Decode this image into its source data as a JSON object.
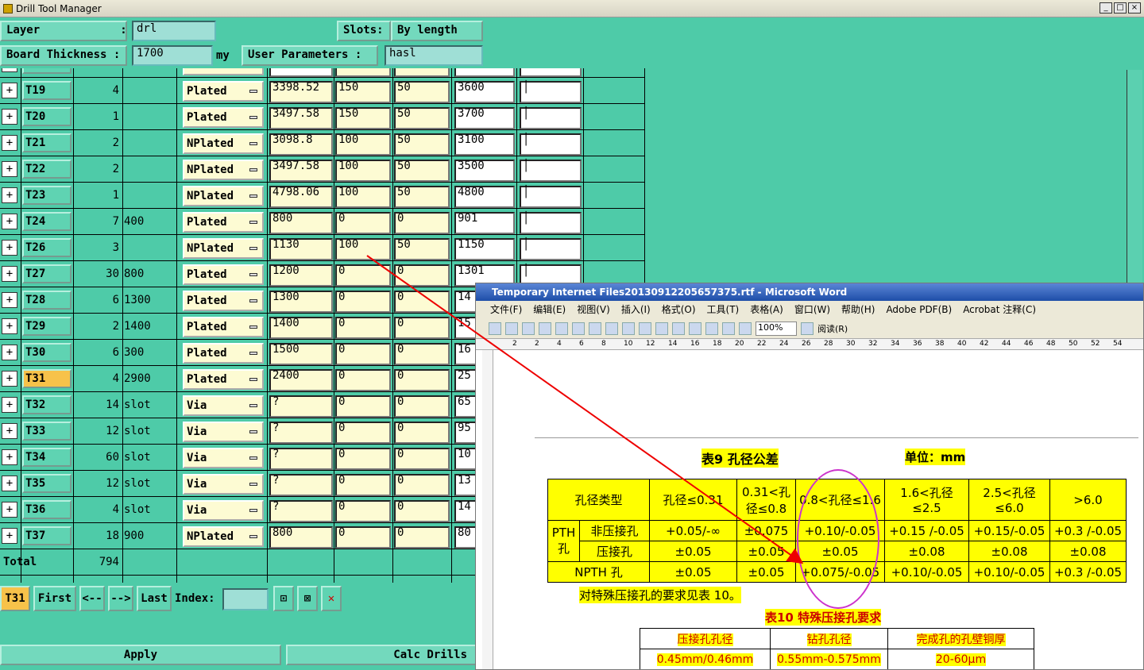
{
  "window": {
    "title": "Drill Tool Manager"
  },
  "header": {
    "layer_label": "Layer            :",
    "layer_value": "drl",
    "slots_label": "Slots:",
    "slots_value": "By length",
    "board_label": "Board Thickness :",
    "board_value": "1700",
    "board_unit": "my",
    "user_params_label": "User Parameters :",
    "user_params_value": "hasl"
  },
  "rows": [
    {
      "tool": "T19",
      "count": "4",
      "minor": "",
      "type": "Plated",
      "c1": "3398.52",
      "c2": "150",
      "c3": "50",
      "c4": "3600"
    },
    {
      "tool": "T20",
      "count": "1",
      "minor": "",
      "type": "Plated",
      "c1": "3497.58",
      "c2": "150",
      "c3": "50",
      "c4": "3700"
    },
    {
      "tool": "T21",
      "count": "2",
      "minor": "",
      "type": "NPlated",
      "c1": "3098.8",
      "c2": "100",
      "c3": "50",
      "c4": "3100"
    },
    {
      "tool": "T22",
      "count": "2",
      "minor": "",
      "type": "NPlated",
      "c1": "3497.58",
      "c2": "100",
      "c3": "50",
      "c4": "3500"
    },
    {
      "tool": "T23",
      "count": "1",
      "minor": "",
      "type": "NPlated",
      "c1": "4798.06",
      "c2": "100",
      "c3": "50",
      "c4": "4800"
    },
    {
      "tool": "T24",
      "count": "7",
      "minor": "400",
      "type": "Plated",
      "c1": "800",
      "c2": "0",
      "c3": "0",
      "c4": "901"
    },
    {
      "tool": "T26",
      "count": "3",
      "minor": "",
      "type": "NPlated",
      "c1": "1130",
      "c2": "100",
      "c3": "50",
      "c4": "1150"
    },
    {
      "tool": "T27",
      "count": "30",
      "minor": "800",
      "type": "Plated",
      "c1": "1200",
      "c2": "0",
      "c3": "0",
      "c4": "1301"
    },
    {
      "tool": "T28",
      "count": "6",
      "minor": "1300",
      "type": "Plated",
      "c1": "1300",
      "c2": "0",
      "c3": "0",
      "c4": "14"
    },
    {
      "tool": "T29",
      "count": "2",
      "minor": "1400",
      "type": "Plated",
      "c1": "1400",
      "c2": "0",
      "c3": "0",
      "c4": "15"
    },
    {
      "tool": "T30",
      "count": "6",
      "minor": "300",
      "type": "Plated",
      "c1": "1500",
      "c2": "0",
      "c3": "0",
      "c4": "16"
    },
    {
      "tool": "T31",
      "count": "4",
      "minor": "2900",
      "type": "Plated",
      "c1": "2400",
      "c2": "0",
      "c3": "0",
      "c4": "25"
    },
    {
      "tool": "T32",
      "count": "14",
      "minor": "slot",
      "type": "Via",
      "c1": "?",
      "c2": "0",
      "c3": "0",
      "c4": "65"
    },
    {
      "tool": "T33",
      "count": "12",
      "minor": "slot",
      "type": "Via",
      "c1": "?",
      "c2": "0",
      "c3": "0",
      "c4": "95"
    },
    {
      "tool": "T34",
      "count": "60",
      "minor": "slot",
      "type": "Via",
      "c1": "?",
      "c2": "0",
      "c3": "0",
      "c4": "10"
    },
    {
      "tool": "T35",
      "count": "12",
      "minor": "slot",
      "type": "Via",
      "c1": "?",
      "c2": "0",
      "c3": "0",
      "c4": "13"
    },
    {
      "tool": "T36",
      "count": "4",
      "minor": "slot",
      "type": "Via",
      "c1": "?",
      "c2": "0",
      "c3": "0",
      "c4": "14"
    },
    {
      "tool": "T37",
      "count": "18",
      "minor": "900",
      "type": "NPlated",
      "c1": "800",
      "c2": "0",
      "c3": "0",
      "c4": "80"
    }
  ],
  "partial_row": {
    "type": "Plated"
  },
  "selected_tool": "T31",
  "total": {
    "label": "Total",
    "count": "794"
  },
  "nav": {
    "current": "T31",
    "first": "First",
    "prev": "<--",
    "next": "-->",
    "last": "Last",
    "index_label": "Index:"
  },
  "actions": {
    "apply": "Apply",
    "calc": "Calc Drills"
  },
  "word": {
    "title": "Temporary Internet Files20130912205657375.rtf - Microsoft Word",
    "menu": [
      "文件(F)",
      "编辑(E)",
      "视图(V)",
      "插入(I)",
      "格式(O)",
      "工具(T)",
      "表格(A)",
      "窗口(W)",
      "帮助(H)",
      "Adobe PDF(B)",
      "Acrobat 注释(C)"
    ],
    "zoom": "100%",
    "read": "阅读(R)",
    "ruler": [
      "2",
      "2",
      "4",
      "6",
      "8",
      "10",
      "12",
      "14",
      "16",
      "18",
      "20",
      "22",
      "24",
      "26",
      "28",
      "30",
      "32",
      "34",
      "36",
      "38",
      "40",
      "42",
      "44",
      "46",
      "48",
      "50",
      "52",
      "54"
    ],
    "t9_title": "表9   孔径公差",
    "t9_unit": "单位：mm",
    "t9_head": [
      "孔径类型",
      "孔径≤0.31",
      "0.31<孔径≤0.8",
      "0.8<孔径≤1.6",
      "1.6<孔径≤2.5",
      "2.5<孔径≤6.0",
      ">6.0"
    ],
    "t9_pth": "PTH孔",
    "t9_rows": [
      {
        "label": "非压接孔",
        "vals": [
          "+0.05/-∞",
          "±0.075",
          "+0.10/-0.05",
          "+0.15 /-0.05",
          "+0.15/-0.05",
          "+0.3 /-0.05"
        ]
      },
      {
        "label": "压接孔",
        "vals": [
          "±0.05",
          "±0.05",
          "±0.05",
          "±0.08",
          "±0.08",
          "±0.08"
        ]
      },
      {
        "label": "NPTH 孔",
        "vals": [
          "±0.05",
          "±0.05",
          "+0.075/-0.05",
          "+0.10/-0.05",
          "+0.10/-0.05",
          "+0.3 /-0.05"
        ]
      }
    ],
    "note": "对特殊压接孔的要求见表 10。",
    "t10_title": "表10   特殊压接孔要求",
    "t10_head": [
      "压接孔孔径",
      "钻孔孔径",
      "完成孔的孔壁铜厚"
    ],
    "t10_row": [
      "0.45mm/0.46mm",
      "0.55mm-0.575mm",
      "20-60μm"
    ]
  }
}
